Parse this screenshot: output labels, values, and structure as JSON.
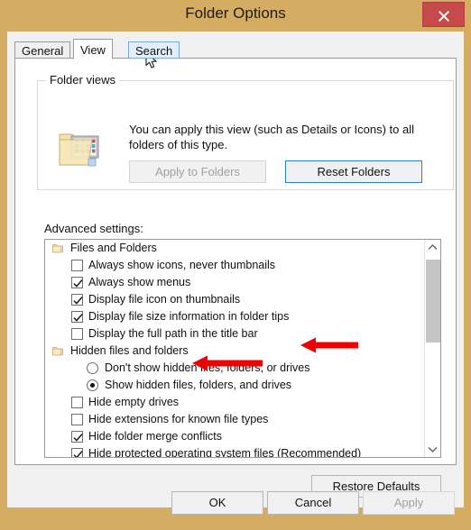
{
  "window": {
    "title": "Folder Options",
    "close_label": "×",
    "titlebar_color": "#d4ad63",
    "close_button_color": "#c74a4a"
  },
  "tabs": [
    {
      "label": "General",
      "state": "normal"
    },
    {
      "label": "View",
      "state": "active"
    },
    {
      "label": "Search",
      "state": "hover"
    }
  ],
  "folder_views": {
    "legend": "Folder views",
    "icon": "folder-view-icon",
    "description": "You can apply this view (such as Details or Icons) to all folders of this type.",
    "apply_button": {
      "label": "Apply to Folders",
      "enabled": false
    },
    "reset_button": {
      "label": "Reset Folders",
      "enabled": true,
      "focus_color": "#2a7fd4"
    }
  },
  "advanced": {
    "label": "Advanced settings:",
    "rows": [
      {
        "type": "group",
        "label": "Files and Folders"
      },
      {
        "type": "checkbox",
        "label": "Always show icons, never thumbnails",
        "checked": false
      },
      {
        "type": "checkbox",
        "label": "Always show menus",
        "checked": true
      },
      {
        "type": "checkbox",
        "label": "Display file icon on thumbnails",
        "checked": true
      },
      {
        "type": "checkbox",
        "label": "Display file size information in folder tips",
        "checked": true
      },
      {
        "type": "checkbox",
        "label": "Display the full path in the title bar",
        "checked": false
      },
      {
        "type": "group",
        "label": "Hidden files and folders"
      },
      {
        "type": "radio",
        "label": "Don't show hidden files, folders, or drives",
        "checked": false
      },
      {
        "type": "radio",
        "label": "Show hidden files, folders, and drives",
        "checked": true
      },
      {
        "type": "checkbox",
        "label": "Hide empty drives",
        "checked": false
      },
      {
        "type": "checkbox",
        "label": "Hide extensions for known file types",
        "checked": false
      },
      {
        "type": "checkbox",
        "label": "Hide folder merge conflicts",
        "checked": true
      },
      {
        "type": "checkbox",
        "label": "Hide protected operating system files (Recommended)",
        "checked": true
      },
      {
        "type": "checkbox",
        "label": "",
        "checked": false
      }
    ],
    "scrollbar": {
      "up_icon": "chevron-up-icon",
      "down_icon": "chevron-down-icon",
      "thumb_position": "top"
    }
  },
  "restore_defaults": {
    "label": "Restore Defaults"
  },
  "footer": {
    "ok": {
      "label": "OK",
      "enabled": true
    },
    "cancel": {
      "label": "Cancel",
      "enabled": true
    },
    "apply": {
      "label": "Apply",
      "enabled": false
    }
  },
  "annotations": {
    "color": "#ee0000",
    "arrows": [
      {
        "name": "arrow-show-hidden-files",
        "points_to": "Show hidden files, folders, and drives"
      },
      {
        "name": "arrow-hide-empty-drives",
        "points_to": "Hide empty drives"
      }
    ]
  },
  "cursor": {
    "type": "arrow-pointer"
  }
}
